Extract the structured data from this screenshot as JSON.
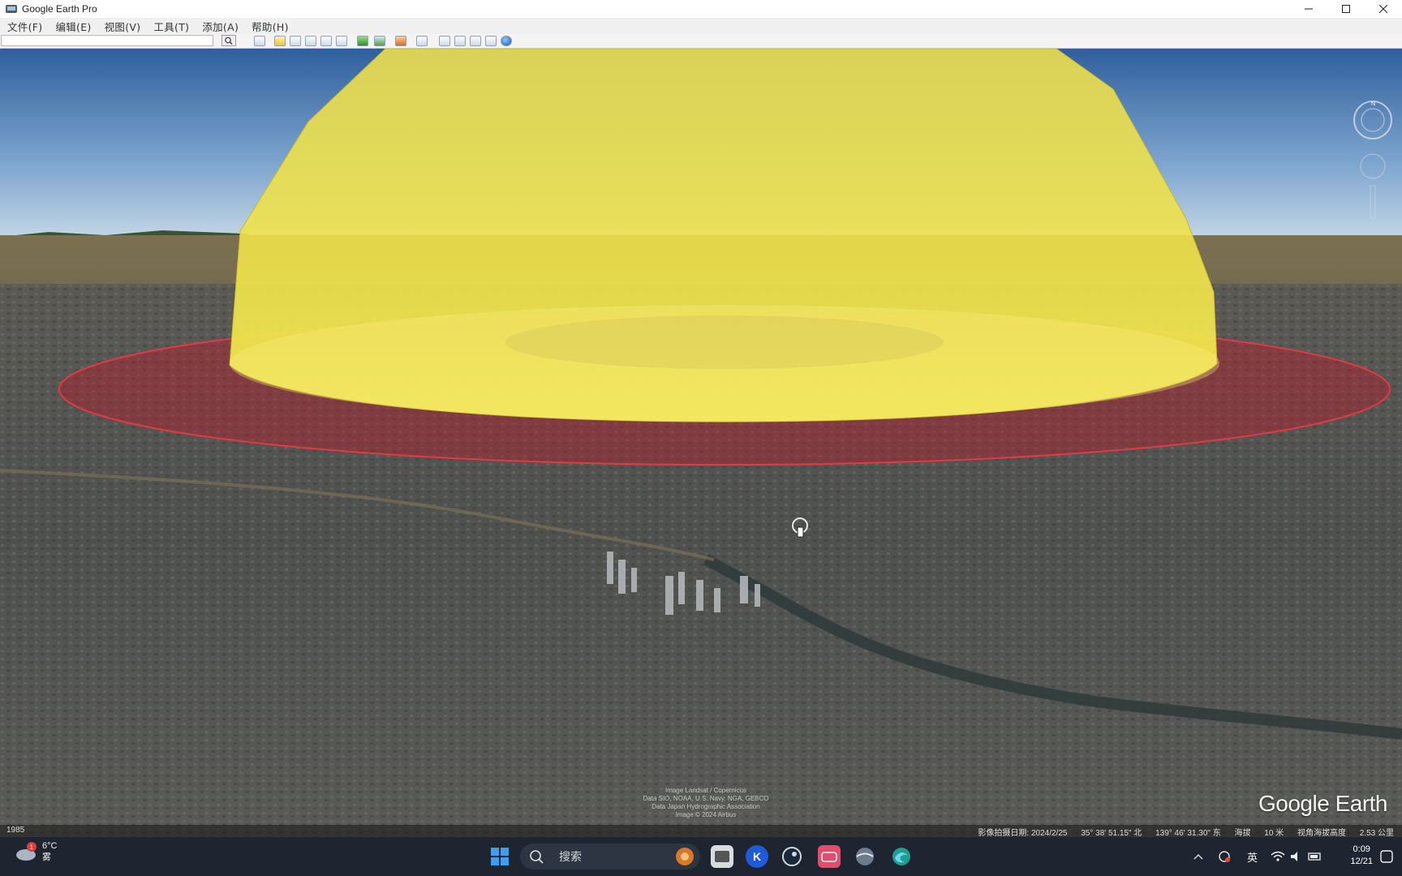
{
  "window": {
    "title": "Google Earth Pro",
    "controls": [
      "minimize",
      "maximize",
      "close"
    ]
  },
  "menu": {
    "items": [
      "文件(F)",
      "编辑(E)",
      "视图(V)",
      "工具(T)",
      "添加(A)",
      "帮助(H)"
    ]
  },
  "toolbar": {
    "search_value": "",
    "icons": [
      "sidebar-icon",
      "placemark-icon",
      "polygon-icon",
      "path-icon",
      "image-overlay-icon",
      "tour-icon",
      "historical-imagery-icon",
      "sun-icon",
      "planets-icon",
      "ruler-icon",
      "email-icon",
      "print-icon",
      "save-image-icon",
      "maps-icon",
      "globe-icon"
    ]
  },
  "viewport": {
    "logo": "Google Earth",
    "attribution": [
      "Image Landsat / Copernicus",
      "Data SIO, NOAA, U.S. Navy, NGA, GEBCO",
      "Data Japan Hydrographic Association",
      "Image © 2024 Airbus"
    ],
    "overlay_colors": {
      "dome": "#f2e43a",
      "ring": "#c8222e"
    }
  },
  "statusbar": {
    "left": "1985",
    "imagery_date": "影像拍摄日期: 2024/2/25",
    "lat": "35° 38' 51.15\" 北",
    "lon": "139° 46' 31.30\" 东",
    "elevation_label": "海拔",
    "elevation": "10 米",
    "eye_alt_label": "视角海拔高度",
    "eye_alt": "2.53 公里"
  },
  "taskbar": {
    "weather_temp": "6°C",
    "weather_desc": "雾",
    "weather_badge": "1",
    "search_placeholder": "搜索",
    "input_method": "英",
    "time": "0:09",
    "date": "12/21"
  }
}
